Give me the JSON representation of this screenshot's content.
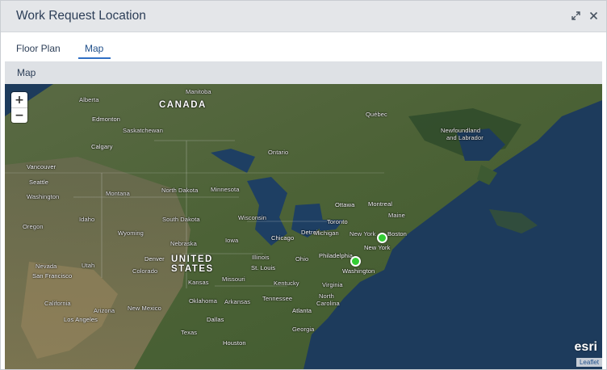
{
  "window": {
    "title": "Work Request Location",
    "actions": {
      "expand_icon": "expand-icon",
      "close_icon": "close-icon"
    }
  },
  "tabs": [
    {
      "label": "Floor Plan",
      "active": false
    },
    {
      "label": "Map",
      "active": true
    }
  ],
  "section": {
    "label": "Map"
  },
  "map": {
    "zoom_in": "+",
    "zoom_out": "−",
    "country_labels": {
      "canada": "CANADA",
      "united": "UNITED",
      "states": "STATES"
    },
    "labels": {
      "alberta": "Alberta",
      "manitoba": "Manitoba",
      "edmonton": "Edmonton",
      "saskatchewan": "Saskatchewan",
      "calgary": "Calgary",
      "vancouver": "Vancouver",
      "seattle": "Seattle",
      "washington": "Washington",
      "montana": "Montana",
      "north_dakota": "North Dakota",
      "minnesota": "Minnesota",
      "ontario": "Ontario",
      "quebec": "Québec",
      "newfoundland": "Newfoundland",
      "labrador": "and Labrador",
      "idaho": "Idaho",
      "south_dakota": "South Dakota",
      "wisconsin": "Wisconsin",
      "ottawa": "Ottawa",
      "montreal": "Montreal",
      "maine": "Maine",
      "toronto": "Toronto",
      "boston": "Boston",
      "oregon": "Oregon",
      "wyoming": "Wyoming",
      "iowa": "Iowa",
      "chicago": "Chicago",
      "detroit": "Detroit",
      "michigan": "Michigan",
      "new_york": "New York",
      "new_york_city": "New York",
      "nebraska": "Nebraska",
      "nevada": "Nevada",
      "utah": "Utah",
      "denver": "Denver",
      "colorado": "Colorado",
      "kansas": "Kansas",
      "missouri": "Missouri",
      "illinois": "Illinois",
      "ohio": "Ohio",
      "philadelphia": "Philadelphia",
      "washington_dc": "Washington",
      "st_louis": "St. Louis",
      "kentucky": "Kentucky",
      "virginia": "Virginia",
      "san_francisco": "San Francisco",
      "california": "California",
      "los_angeles": "Los Angeles",
      "arizona": "Arizona",
      "new_mexico": "New Mexico",
      "oklahoma": "Oklahoma",
      "arkansas": "Arkansas",
      "tennessee": "Tennessee",
      "north_carolina": "North",
      "north_carolina2": "Carolina",
      "atlanta": "Atlanta",
      "dallas": "Dallas",
      "georgia": "Georgia",
      "texas": "Texas",
      "houston": "Houston"
    },
    "markers": [
      {
        "name": "marker-new-york"
      },
      {
        "name": "marker-washington"
      }
    ],
    "logo": "esri",
    "attribution": "Leaflet"
  },
  "colors": {
    "title_bar": "#e4e6e9",
    "accent": "#2f6fc4",
    "marker": "#33cc33",
    "ocean": "#1e3a5a"
  }
}
